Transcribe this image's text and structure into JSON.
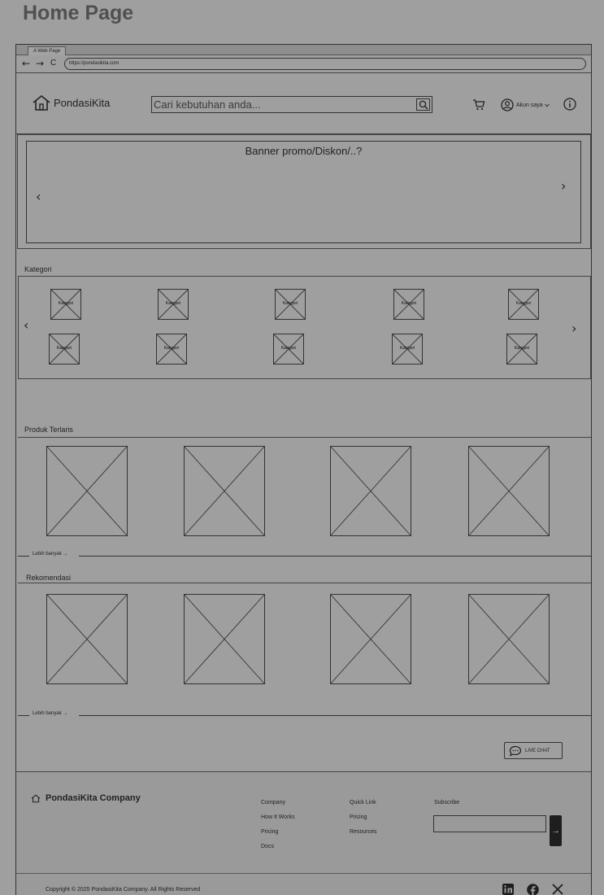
{
  "page_title": "Home Page",
  "browser": {
    "tab_title": "A Web Page",
    "back": "←",
    "forward": "→",
    "reload": "C",
    "url": "https://pondasikita.com"
  },
  "header": {
    "logo_text": "PondasiKita",
    "search_placeholder": "Cari kebutuhan anda...",
    "account_label": "Akun saya"
  },
  "banner": {
    "text": "Banner promo/Diskon/..?",
    "prev": "‹",
    "next": "›"
  },
  "kategori": {
    "title": "Kategori",
    "prev": "‹",
    "next": "›",
    "items": [
      "Kategori",
      "Kategori",
      "Kategori",
      "Kategori",
      "Kategori",
      "Kategori",
      "Kategori",
      "Kategori",
      "Kategori",
      "Kategori"
    ]
  },
  "produk_terlaris": {
    "title": "Produk Terlaris",
    "more_label": "Lebih banyak →"
  },
  "rekomendasi": {
    "title": "Rekomendasi",
    "more_label": "Lebih banyak →"
  },
  "live_chat": {
    "label": "LIVE CHAT"
  },
  "footer": {
    "brand": "PondasiKita Company",
    "company": {
      "title": "Company",
      "links": [
        "How It Works",
        "Pricing",
        "Docs"
      ]
    },
    "quick_link": {
      "title": "Quick Link",
      "links": [
        "Pricing",
        "Resources"
      ]
    },
    "subscribe": {
      "title": "Subscribe",
      "button": "→"
    },
    "copyright": "Copyright © 2025 PondasiKita Company. All Rights Reserved"
  },
  "icons": [
    "home-icon",
    "search-icon",
    "cart-icon",
    "user-icon",
    "info-icon",
    "chat-icon",
    "linkedin-icon",
    "facebook-icon",
    "x-icon"
  ]
}
